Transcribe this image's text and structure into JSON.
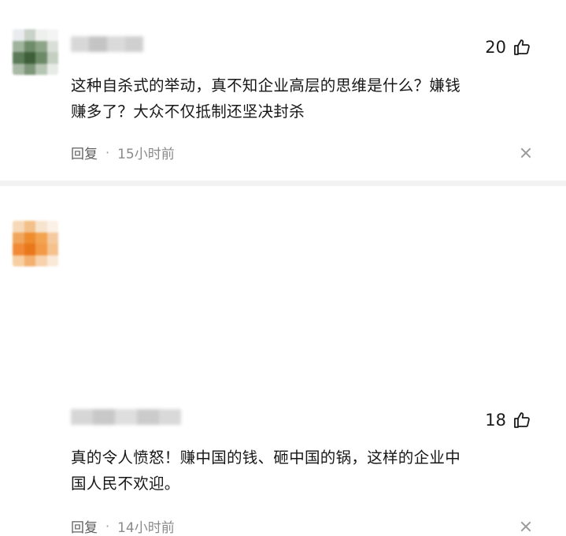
{
  "comments": [
    {
      "likes": "20",
      "text_line1": "这种自杀式的举动，真不知企业高层的思维是什么？嫌钱",
      "text_line2": "赚多了？大众不仅抵制还坚决封杀",
      "reply_label": "回复",
      "separator": "·",
      "time": "15小时前",
      "avatar_colors": [
        "#e9ecef",
        "#c9d2c8",
        "#eef0ee",
        "#f4f4f4",
        "#9fb39d",
        "#6e8c6a",
        "#8ea488",
        "#d9dfd8",
        "#5c7b58",
        "#3f5f3b",
        "#6c8a67",
        "#c4cfc2",
        "#a9b9a6",
        "#7e967a",
        "#b7c5b4",
        "#e8ece7"
      ]
    },
    {
      "likes": "18",
      "text_line1": "真的令人愤怒！赚中国的钱、砸中国的锅，这样的企业中",
      "text_line2": "国人民不欢迎。",
      "reply_label": "回复",
      "separator": "·",
      "time": "14小时前",
      "avatar_colors": [
        "#f6d9b8",
        "#f3c08a",
        "#f7e4cf",
        "#fbf1e6",
        "#f0a65c",
        "#ee8c2e",
        "#f2a450",
        "#f6caa0",
        "#f08a36",
        "#e9781c",
        "#f39a48",
        "#f5c28e",
        "#f8cfa2",
        "#f4b070",
        "#f7d2ac",
        "#fbe9d7"
      ]
    }
  ],
  "icons": {
    "like": "thumbs-up-icon",
    "close": "close-icon"
  }
}
